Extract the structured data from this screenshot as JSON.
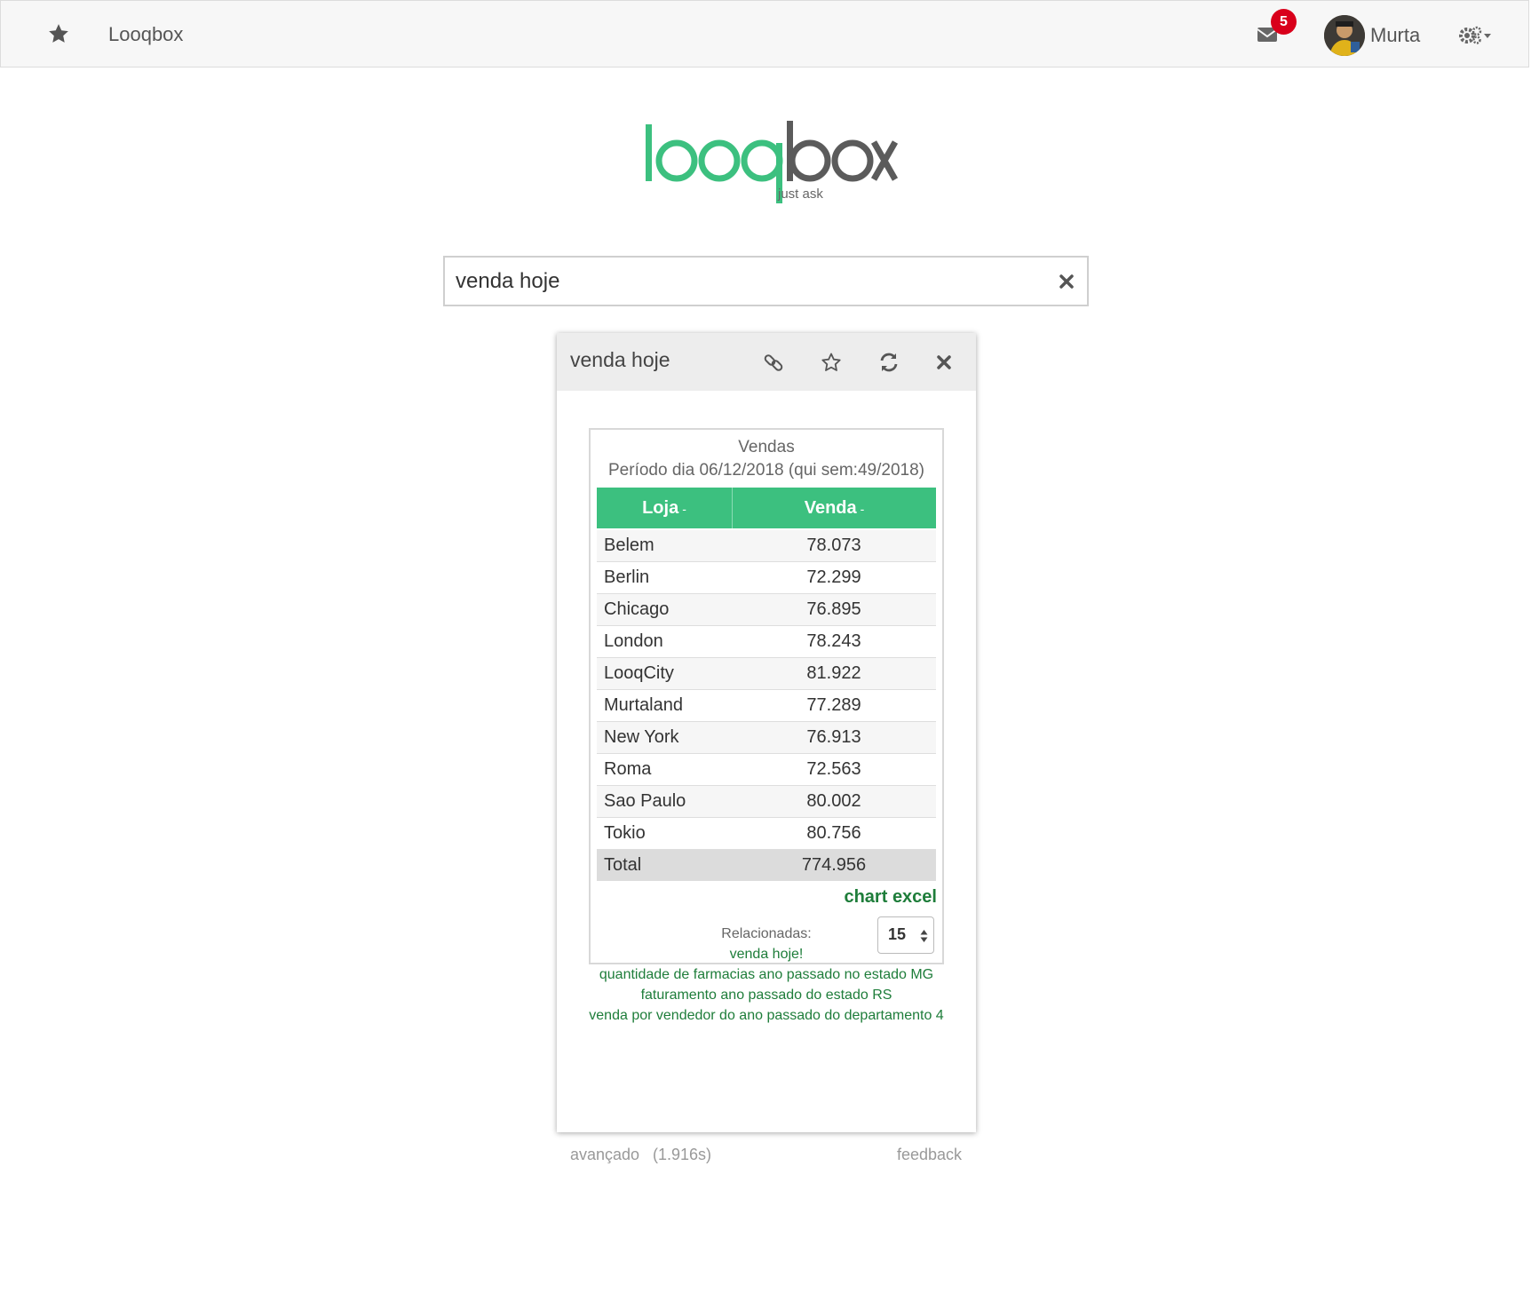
{
  "nav": {
    "brand": "Looqbox",
    "notifications_count": "5",
    "user_name": "Murta"
  },
  "logo": {
    "text_green": "looq",
    "text_gray": "box",
    "tagline": "just ask",
    "colors": {
      "green": "#3cc07f",
      "gray": "#5b5b5b"
    }
  },
  "search": {
    "value": "venda hoje"
  },
  "card": {
    "title": "venda hoje",
    "table": {
      "title": "Vendas",
      "subtitle": "Período dia 06/12/2018 (qui sem:49/2018)",
      "columns": [
        "Loja",
        "Venda"
      ],
      "sort_marker": "-",
      "rows": [
        [
          "Belem",
          "78.073"
        ],
        [
          "Berlin",
          "72.299"
        ],
        [
          "Chicago",
          "76.895"
        ],
        [
          "London",
          "78.243"
        ],
        [
          "LooqCity",
          "81.922"
        ],
        [
          "Murtaland",
          "77.289"
        ],
        [
          "New York",
          "76.913"
        ],
        [
          "Roma",
          "72.563"
        ],
        [
          "Sao Paulo",
          "80.002"
        ],
        [
          "Tokio",
          "80.756"
        ]
      ],
      "total": [
        "Total",
        "774.956"
      ],
      "chart_link": "chart",
      "excel_link": "excel",
      "page_size": "15",
      "header_color": "#3cc07f"
    },
    "related": {
      "label": "Relacionadas:",
      "items": [
        "venda hoje!",
        "quantidade de farmacias ano passado no estado MG",
        "faturamento ano passado do estado RS",
        "venda por vendedor do ano passado do departamento 4"
      ]
    }
  },
  "footer": {
    "advanced": "avançado",
    "time": "(1.916s)",
    "feedback": "feedback"
  }
}
